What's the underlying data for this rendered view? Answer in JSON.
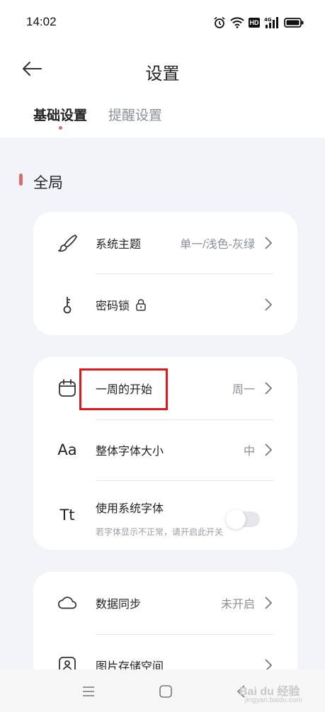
{
  "status_bar": {
    "time": "14:02",
    "icons": [
      "alarm-icon",
      "wifi-icon",
      "hd-badge",
      "signal-4g-icon",
      "battery-icon"
    ],
    "hd_label": "HD"
  },
  "header": {
    "title": "设置",
    "tabs": [
      {
        "label": "基础设置",
        "active": true
      },
      {
        "label": "提醒设置",
        "active": false
      }
    ]
  },
  "section": {
    "title": "全局"
  },
  "cards": [
    {
      "rows": [
        {
          "icon": "brush-icon",
          "label": "系统主题",
          "value": "单一/浅色-灰绿"
        },
        {
          "icon": "key-icon",
          "label": "密码锁",
          "label_icon": "lock-icon",
          "value": ""
        }
      ]
    },
    {
      "rows": [
        {
          "icon": "calendar-icon",
          "label": "一周的开始",
          "value": "周一"
        },
        {
          "icon": "font-size-icon",
          "icon_text": "Aa",
          "label": "整体字体大小",
          "value": "中"
        },
        {
          "icon": "system-font-icon",
          "icon_text": "Tt",
          "label": "使用系统字体",
          "sublabel": "若字体显示不正常，请开启此开关",
          "toggle": false
        }
      ]
    },
    {
      "rows": [
        {
          "icon": "cloud-icon",
          "label": "数据同步",
          "value": "未开启"
        },
        {
          "icon": "image-storage-icon",
          "label": "图片存储空间",
          "value": ""
        }
      ]
    }
  ],
  "colors": {
    "accent_red": "#dc6b6b",
    "background": "#f3f4f9",
    "card": "#ffffff",
    "highlight": "#e01818",
    "muted_text": "#8b8f99"
  },
  "watermark": {
    "text": "Bai du 经验",
    "sub": "jingyan.baidu.com"
  }
}
